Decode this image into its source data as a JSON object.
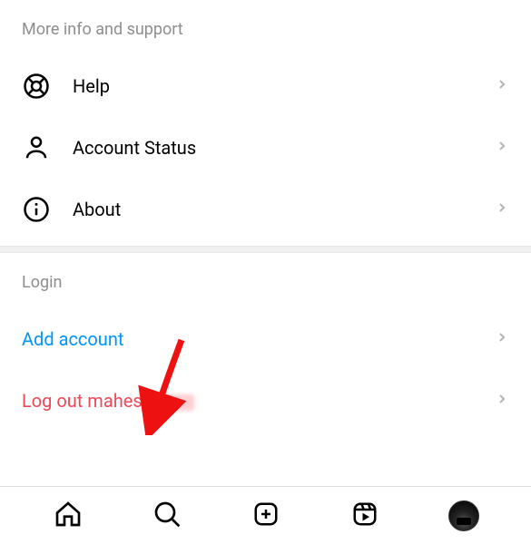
{
  "section_info": {
    "title": "More info and support",
    "items": [
      {
        "label": "Help"
      },
      {
        "label": "Account Status"
      },
      {
        "label": "About"
      }
    ]
  },
  "section_login": {
    "title": "Login",
    "add_account_label": "Add account",
    "logout_label": "Log out mahesh"
  },
  "colors": {
    "link_blue": "#0095f6",
    "link_red": "#ed4956",
    "muted": "#8e8e8e"
  }
}
